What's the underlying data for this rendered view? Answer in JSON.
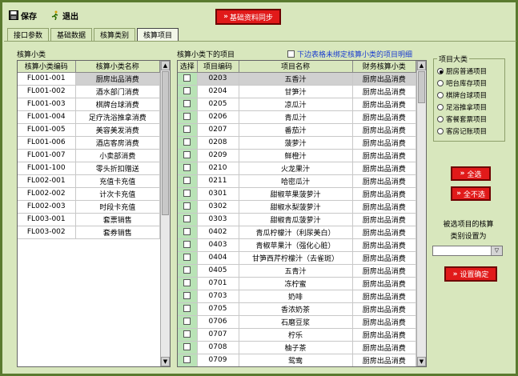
{
  "toolbar": {
    "save_label": "保存",
    "exit_label": "退出",
    "sync_label": "基础资料同步"
  },
  "tabs": [
    {
      "label": "接口参数"
    },
    {
      "label": "基础数据"
    },
    {
      "label": "核算类别"
    },
    {
      "label": "核算项目"
    }
  ],
  "left": {
    "title": "核算小类",
    "headers": [
      "核算小类编码",
      "核算小类名称"
    ],
    "rows": [
      [
        "FL001-001",
        "厨房出品消费"
      ],
      [
        "FL001-002",
        "酒水部门消费"
      ],
      [
        "FL001-003",
        "棋牌台球消费"
      ],
      [
        "FL001-004",
        "足疗洗浴推拿消费"
      ],
      [
        "FL001-005",
        "美容美发消费"
      ],
      [
        "FL001-006",
        "酒店客房消费"
      ],
      [
        "FL001-007",
        "小卖部消费"
      ],
      [
        "FL001-100",
        "零头折扣赠送"
      ],
      [
        "FL002-001",
        "充值卡充值"
      ],
      [
        "FL002-002",
        "计次卡充值"
      ],
      [
        "FL002-003",
        "时段卡充值"
      ],
      [
        "FL003-001",
        "套票销售"
      ],
      [
        "FL003-002",
        "套券销售"
      ]
    ]
  },
  "middle": {
    "title": "核算小类下的项目",
    "unbound_label": "下边表格未绑定核算小类的项目明细",
    "headers": [
      "选择",
      "项目编码",
      "项目名称",
      "财务核算小类"
    ],
    "rows": [
      [
        "0203",
        "五香汁",
        "厨房出品消费"
      ],
      [
        "0204",
        "甘笋汁",
        "厨房出品消费"
      ],
      [
        "0205",
        "凉瓜汁",
        "厨房出品消费"
      ],
      [
        "0206",
        "青瓜汁",
        "厨房出品消费"
      ],
      [
        "0207",
        "番茄汁",
        "厨房出品消费"
      ],
      [
        "0208",
        "菠萝汁",
        "厨房出品消费"
      ],
      [
        "0209",
        "鲜橙汁",
        "厨房出品消费"
      ],
      [
        "0210",
        "火龙果汁",
        "厨房出品消费"
      ],
      [
        "0211",
        "哈密瓜汁",
        "厨房出品消费"
      ],
      [
        "0301",
        "甜椒苹果菠萝汁",
        "厨房出品消费"
      ],
      [
        "0302",
        "甜椒水梨菠萝汁",
        "厨房出品消费"
      ],
      [
        "0303",
        "甜椒青瓜菠萝汁",
        "厨房出品消费"
      ],
      [
        "0402",
        "青瓜柠檬汁（利尿美白）",
        "厨房出品消费"
      ],
      [
        "0403",
        "青椒苹果汁（强化心脏）",
        "厨房出品消费"
      ],
      [
        "0404",
        "甘笋西芹柠檬汁（去雀斑）",
        "厨房出品消费"
      ],
      [
        "0405",
        "五青汁",
        "厨房出品消费"
      ],
      [
        "0701",
        "冻柠蜜",
        "厨房出品消费"
      ],
      [
        "0703",
        "奶啡",
        "厨房出品消费"
      ],
      [
        "0705",
        "香浓奶茶",
        "厨房出品消费"
      ],
      [
        "0706",
        "石磨豆浆",
        "厨房出品消费"
      ],
      [
        "0707",
        "柠乐",
        "厨房出品消费"
      ],
      [
        "0708",
        "柚子茶",
        "厨房出品消费"
      ],
      [
        "0709",
        "鸳鸯",
        "厨房出品消费"
      ]
    ]
  },
  "right": {
    "group_title": "项目大类",
    "options": [
      {
        "label": "厨房普通项目",
        "selected": true
      },
      {
        "label": "吧台库存项目",
        "selected": false
      },
      {
        "label": "棋牌台球项目",
        "selected": false
      },
      {
        "label": "足浴推拿项目",
        "selected": false
      },
      {
        "label": "客餐套票项目",
        "selected": false
      },
      {
        "label": "客房记账项目",
        "selected": false
      }
    ],
    "select_all": "全选",
    "select_none": "全不选",
    "note_line1": "被选项目的核算",
    "note_line2": "类别设置为",
    "combo_value": "",
    "confirm": "设置确定"
  },
  "colors": {
    "background": "#d8e7bd",
    "border": "#5a7a2f",
    "accent_red": "#e11a1a",
    "check_column": "#b9e3b6"
  }
}
